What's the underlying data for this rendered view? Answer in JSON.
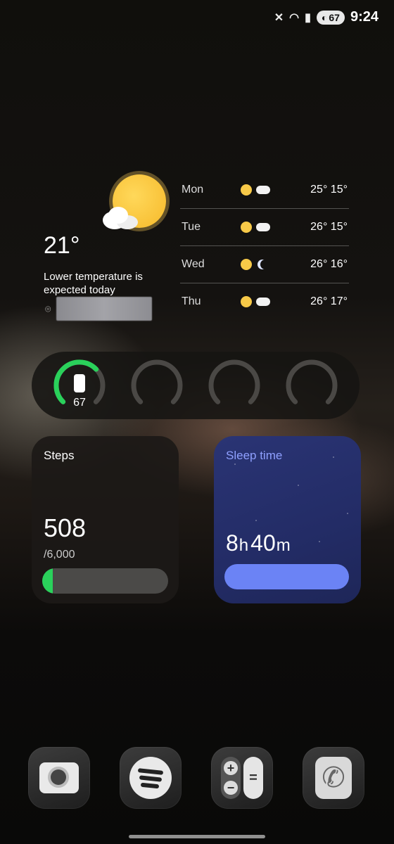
{
  "status_bar": {
    "time": "9:24",
    "battery": "67",
    "icons": [
      "mute-icon",
      "wifi-icon",
      "signal-icon",
      "battery-icon"
    ]
  },
  "weather": {
    "current_temp": "21°",
    "description": "Lower temperature is expected today",
    "icon": "partly-sunny-icon",
    "forecast": [
      {
        "day": "Mon",
        "temps": "25° 15°",
        "icons": [
          "sun-icon",
          "cloudy-night-icon"
        ]
      },
      {
        "day": "Tue",
        "temps": "26° 15°",
        "icons": [
          "partly-sunny-icon",
          "cloudy-night-icon"
        ]
      },
      {
        "day": "Wed",
        "temps": "26° 16°",
        "icons": [
          "partly-sunny-icon",
          "moon-icon"
        ]
      },
      {
        "day": "Thu",
        "temps": "26° 17°",
        "icons": [
          "partly-sunny-icon",
          "cloudy-night-icon"
        ]
      }
    ]
  },
  "battery_widget": {
    "rings": [
      {
        "label": "67",
        "level": 0.67,
        "icon": "phone-icon"
      },
      {
        "label": "",
        "level": 0
      },
      {
        "label": "",
        "level": 0
      },
      {
        "label": "",
        "level": 0
      }
    ],
    "colors": {
      "active": "#2ad15b",
      "track": "#4a4845"
    }
  },
  "steps": {
    "title": "Steps",
    "value": "508",
    "goal": "/6,000",
    "progress": 0.085
  },
  "sleep": {
    "title": "Sleep time",
    "hours": "8",
    "hours_unit": "h",
    "minutes": "40",
    "minutes_unit": "m"
  },
  "dock": {
    "apps": [
      {
        "name": "camera-app",
        "icon": "camera-icon"
      },
      {
        "name": "spotify-app",
        "icon": "spotify-icon"
      },
      {
        "name": "calculator-app",
        "icon": "calculator-icon"
      },
      {
        "name": "phone-app",
        "icon": "phone-call-icon"
      }
    ],
    "calculator_symbols": [
      "+",
      "−",
      "="
    ],
    "phone_glyph": "✆"
  }
}
